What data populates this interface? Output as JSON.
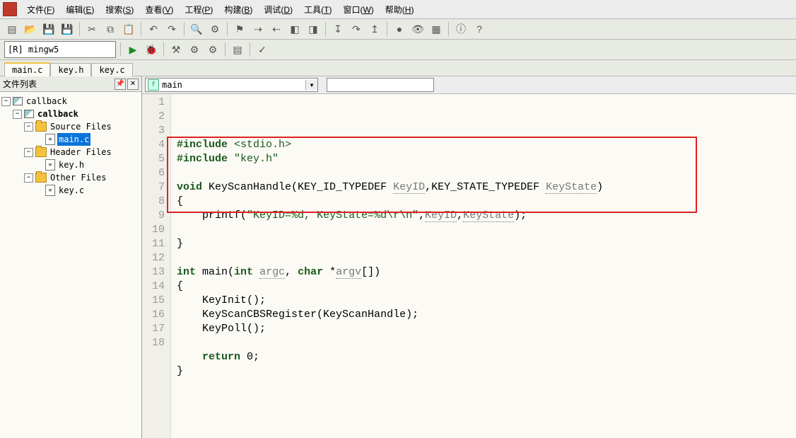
{
  "menu": {
    "items": [
      {
        "label": "文件",
        "mn": "F"
      },
      {
        "label": "编辑",
        "mn": "E"
      },
      {
        "label": "搜索",
        "mn": "S"
      },
      {
        "label": "查看",
        "mn": "V"
      },
      {
        "label": "工程",
        "mn": "P"
      },
      {
        "label": "构建",
        "mn": "B"
      },
      {
        "label": "调试",
        "mn": "D"
      },
      {
        "label": "工具",
        "mn": "T"
      },
      {
        "label": "窗口",
        "mn": "W"
      },
      {
        "label": "帮助",
        "mn": "H"
      }
    ]
  },
  "compiler": {
    "name": "[R] mingw5"
  },
  "doc_tabs": [
    {
      "name": "main.c",
      "active": true
    },
    {
      "name": "key.h",
      "active": false
    },
    {
      "name": "key.c",
      "active": false
    }
  ],
  "file_panel": {
    "title": "文件列表",
    "tree": {
      "name": "callback",
      "children": [
        {
          "name": "callback",
          "bold": true,
          "type": "project",
          "children": [
            {
              "name": "Source Files",
              "type": "folder",
              "children": [
                {
                  "name": "main.c",
                  "type": "file",
                  "selected": true
                }
              ]
            },
            {
              "name": "Header Files",
              "type": "folder",
              "children": [
                {
                  "name": "key.h",
                  "type": "file"
                }
              ]
            },
            {
              "name": "Other Files",
              "type": "folder",
              "children": [
                {
                  "name": "key.c",
                  "type": "file"
                }
              ]
            }
          ]
        }
      ]
    }
  },
  "func_dropdown": {
    "icon": "f",
    "name": "main"
  },
  "code_lines": [
    {
      "n": 1,
      "html": "<span class='kw'>#include</span> <span class='inc'>&lt;stdio.h&gt;</span>"
    },
    {
      "n": 2,
      "html": "<span class='kw'>#include</span> <span class='inc'>\"key.h\"</span>"
    },
    {
      "n": 3,
      "html": ""
    },
    {
      "n": 4,
      "html": "<span class='kw'>void</span> KeyScanHandle(KEY_ID_TYPEDEF <span class='id-u'>KeyID</span>,KEY_STATE_TYPEDEF <span class='id-u'>KeyState</span>)"
    },
    {
      "n": 5,
      "html": "{"
    },
    {
      "n": 6,
      "html": "    printf(<span class='str'>\"KeyID=%d, KeyState=%d\\r\\n\"</span>,<span class='id-u'>KeyID</span>,<span class='id-u'>KeyState</span>);"
    },
    {
      "n": 7,
      "html": ""
    },
    {
      "n": 8,
      "html": "}"
    },
    {
      "n": 9,
      "html": ""
    },
    {
      "n": 10,
      "html": "<span class='kw'>int</span> main(<span class='kw'>int</span> <span class='id-u'>argc</span>, <span class='kw'>char</span> *<span class='id-u'>argv</span>[])"
    },
    {
      "n": 11,
      "html": "{"
    },
    {
      "n": 12,
      "html": "    KeyInit();"
    },
    {
      "n": 13,
      "html": "    KeyScanCBSRegister(KeyScanHandle);"
    },
    {
      "n": 14,
      "html": "    KeyPoll();"
    },
    {
      "n": 15,
      "html": ""
    },
    {
      "n": 16,
      "html": "    <span class='kw'>return</span> 0;"
    },
    {
      "n": 17,
      "html": "}"
    },
    {
      "n": 18,
      "html": ""
    }
  ],
  "toolbar_icons": {
    "row1": [
      "new",
      "open",
      "save",
      "saveall",
      "|",
      "cut",
      "copy",
      "paste",
      "|",
      "undo",
      "redo",
      "|",
      "find",
      "macro",
      "|",
      "bookmark",
      "nextbm",
      "prevbm",
      "dbg1",
      "dbg2",
      "|",
      "step",
      "stepover",
      "stepout",
      "|",
      "break",
      "watch",
      "dbg3",
      "|",
      "info",
      "help"
    ],
    "row2": [
      "|",
      "run",
      "debug",
      "|",
      "compile",
      "build",
      "buildall",
      "|",
      "output",
      "|",
      "make"
    ]
  }
}
